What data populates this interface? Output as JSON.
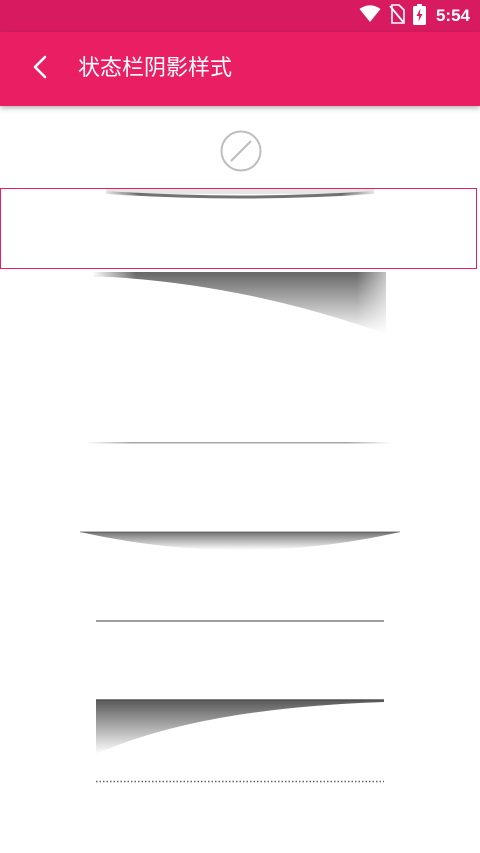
{
  "status_bar": {
    "time": "5:54",
    "icons": [
      "wifi-icon",
      "no-sim-icon",
      "battery-charging-icon"
    ],
    "background": "#d81b60"
  },
  "app_bar": {
    "title": "状态栏阴影样式",
    "back_icon": "chevron-left-icon",
    "background": "#e91e63"
  },
  "options": {
    "none_icon": "no-shadow-icon",
    "selected_index": 1,
    "items": [
      {
        "id": "none"
      },
      {
        "id": "style-1"
      },
      {
        "id": "style-2"
      },
      {
        "id": "style-3"
      },
      {
        "id": "style-4"
      },
      {
        "id": "style-5"
      },
      {
        "id": "style-6"
      },
      {
        "id": "style-7"
      }
    ],
    "accent": "#e91e63"
  }
}
